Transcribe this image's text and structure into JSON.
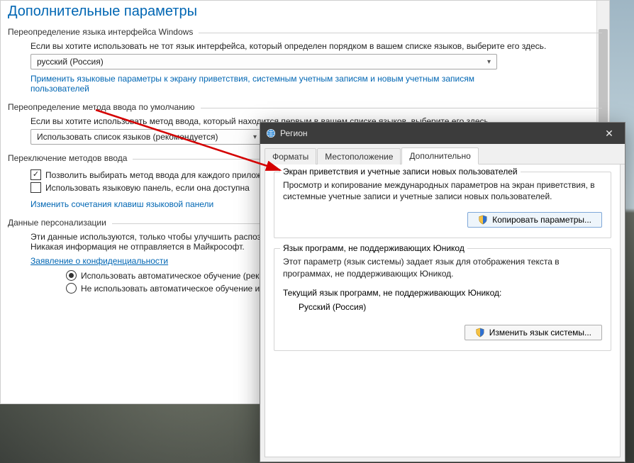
{
  "settings": {
    "heading": "Дополнительные параметры",
    "group_override_lang": {
      "title": "Переопределение языка интерфейса Windows",
      "desc": "Если вы хотите использовать не тот язык интерфейса, который определен порядком в вашем списке языков, выберите его здесь.",
      "select_value": "русский (Россия)",
      "apply_link": "Применить языковые параметры к экрану приветствия, системным учетным записям и новым учетным записям пользователей"
    },
    "group_override_input": {
      "title": "Переопределение метода ввода по умолчанию",
      "desc": "Если вы хотите использовать метод ввода, который находится первым в вашем списке языков, выберите его здесь.",
      "select_value": "Использовать список языков (рекомендуется)"
    },
    "group_switch": {
      "title": "Переключение методов ввода",
      "chk_allow": "Позволить выбирать метод ввода для каждого приложения",
      "chk_langbar": "Использовать языковую панель, если она доступна",
      "link_hotkeys": "Изменить сочетания клавиш языковой панели"
    },
    "group_personal": {
      "title": "Данные персонализации",
      "desc": "Эти данные используются, только чтобы улучшить распознавание рукописного ввода и ввода текста для языков без IME на этом компьютере. Никакая информация не отправляется в Майкрософт.",
      "link_privacy": "Заявление о конфиденциальности",
      "radio_on": "Использовать автоматическое обучение (рекомендуется)",
      "radio_off": "Не использовать автоматическое обучение и удалить все ранее собранные данные"
    }
  },
  "region": {
    "title": "Регион",
    "tabs": {
      "formats": "Форматы",
      "location": "Местоположение",
      "advanced": "Дополнительно"
    },
    "welcome": {
      "legend": "Экран приветствия и учетные записи новых пользователей",
      "desc": "Просмотр и копирование международных параметров на экран приветствия, в системные учетные записи и учетные записи новых пользователей.",
      "button": "Копировать параметры..."
    },
    "nonunicode": {
      "legend": "Язык программ, не поддерживающих Юникод",
      "desc": "Этот параметр (язык системы) задает язык для отображения текста в программах, не поддерживающих Юникод.",
      "current_label": "Текущий язык программ, не поддерживающих Юникод:",
      "current_value": "Русский (Россия)",
      "button": "Изменить язык системы..."
    }
  }
}
